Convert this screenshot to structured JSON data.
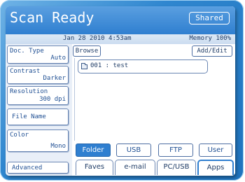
{
  "header": {
    "title": "Scan Ready",
    "shared_label": "Shared"
  },
  "status": {
    "date_time": "Jan 28 2010  4:53am",
    "memory": "Memory  100%"
  },
  "settings": {
    "doc_type": {
      "label": "Doc. Type",
      "value": "Auto"
    },
    "contrast": {
      "label": "Contrast",
      "value": "Darker"
    },
    "resolution": {
      "label": "Resolution",
      "value": "300 dpi"
    },
    "file_name": {
      "label": "File Name"
    },
    "color": {
      "label": "Color",
      "value": "Mono"
    },
    "advanced": {
      "label": "Advanced"
    }
  },
  "browser": {
    "browse_label": "Browse",
    "add_edit_label": "Add/Edit",
    "items": [
      {
        "icon": "folder-icon",
        "label": "001 : test"
      }
    ]
  },
  "scope": {
    "buttons": [
      {
        "label": "Folder",
        "active": true
      },
      {
        "label": "USB",
        "active": false
      },
      {
        "label": "FTP",
        "active": false
      },
      {
        "label": "User",
        "active": false
      }
    ]
  },
  "tabs": [
    {
      "label": "Faves"
    },
    {
      "label": "e-mail"
    },
    {
      "label": "PC/USB"
    },
    {
      "label": "Apps"
    }
  ],
  "colors": {
    "accent": "#2f7fd0",
    "bezel": "#2f86cf",
    "text": "#1f4f93"
  }
}
